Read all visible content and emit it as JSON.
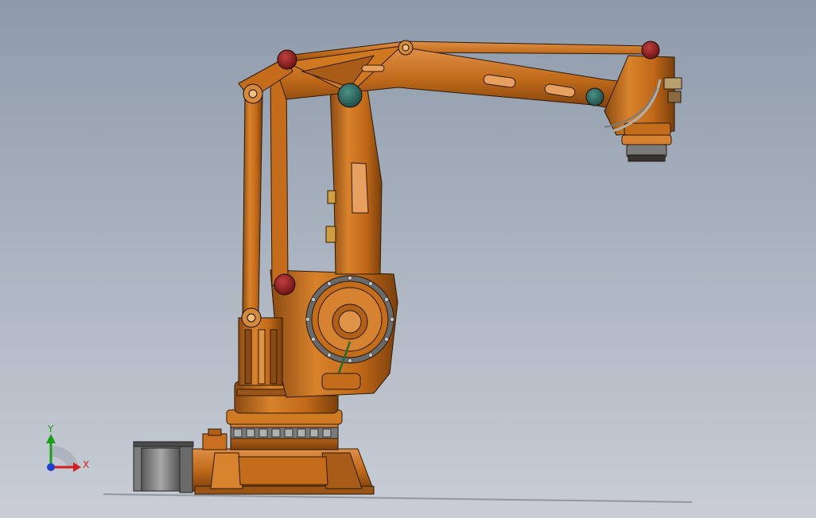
{
  "viewport": {
    "background_top": "#8e9aab",
    "background_bottom": "#c9ced6"
  },
  "robot": {
    "body_color": "#c8701f",
    "body_light": "#e0924a",
    "body_dark": "#7a3f0c",
    "edge_color": "#2a1a08",
    "joint_red": "#9a2020",
    "joint_teal": "#2e6f68",
    "motor_gray": "#8a8a8a",
    "ring_gray": "#5a5a5a"
  },
  "triad": {
    "x_label": "X",
    "y_label": "Y",
    "x_color": "#d22020",
    "y_color": "#1aa01a",
    "z_color": "#2040d0"
  }
}
